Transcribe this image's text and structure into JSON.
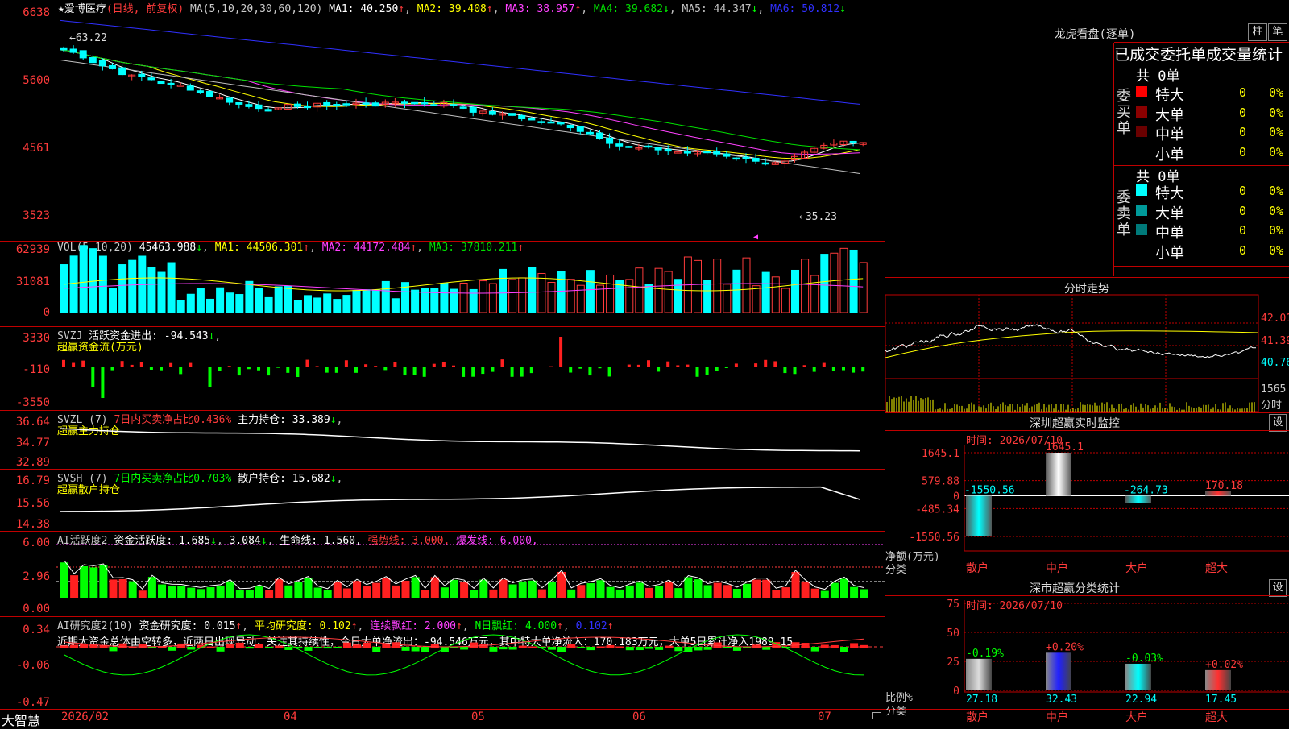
{
  "main": {
    "header": {
      "star": "★",
      "name": "爱博医疗",
      "mode": "(日线, 前复权)",
      "ma_label": "MA(5,10,20,30,60,120)",
      "ma": [
        {
          "text": "MA1: 40.250",
          "arrow": "↑",
          "color": "#ffffff"
        },
        {
          "text": "MA2: 39.408",
          "arrow": "↑",
          "color": "#ffff00"
        },
        {
          "text": "MA3: 38.957",
          "arrow": "↑",
          "color": "#ff40ff"
        },
        {
          "text": "MA4: 39.682",
          "arrow": "↓",
          "color": "#00e000"
        },
        {
          "text": "MA5: 44.347",
          "arrow": "↓",
          "color": "#c0c0c0"
        },
        {
          "text": "MA6: 50.812",
          "arrow": "↓",
          "color": "#3030ff"
        }
      ]
    },
    "yticks": [
      "6638",
      "5600",
      "4561",
      "3523"
    ],
    "high_label": "63.22",
    "low_label": "35.23"
  },
  "vol": {
    "header": "VOL(5,10,20)",
    "value": "45463.988",
    "ma1": "MA1: 44506.301",
    "ma2": "MA2: 44172.484",
    "ma3": "MA3: 37810.211",
    "yticks": [
      "62939",
      "31081",
      "0"
    ]
  },
  "svzj": {
    "header": "SVZJ",
    "label": "活跃资金进出: -94.543",
    "sub": "超赢资金流(万元)",
    "yticks": [
      "3330",
      "-110",
      "-3550"
    ]
  },
  "svzl": {
    "header": "SVZL (7)",
    "ratio": "7日内买卖净占比0.436%",
    "hold": "主力持仓: 33.389",
    "sub": "超赢主力持仓",
    "yticks": [
      "36.64",
      "34.77",
      "32.89"
    ]
  },
  "svsh": {
    "header": "SVSH (7)",
    "ratio": "7日内买卖净占比0.703%",
    "hold": "散户持仓: 15.682",
    "sub": "超赢散户持仓",
    "yticks": [
      "16.79",
      "15.56",
      "14.38"
    ]
  },
  "ai1": {
    "header": "AI活跃度2",
    "a": "资金活跃度: 1.685",
    "b": "3.084",
    "c": "生命线: 1.560,",
    "d": "强势线: 3.000,",
    "e": "爆发线: 6.000,",
    "yticks": [
      "6.00",
      "2.96",
      "0.00"
    ]
  },
  "ai2": {
    "header": "AI研究度2(10)",
    "a": "资金研究度: 0.015",
    "b": "平均研究度: 0.102",
    "c": "连续飘红: 2.000",
    "d": "N日飘红: 4.000",
    "e": "0.102",
    "comment": "近期大资金总体由空转多，近两日出现异动，关注其持续性，今日大单净流出：-94.546万元，其中特大单净流入：170.183万元，大单5日累计净入1989.15",
    "yticks": [
      "0.34",
      "-0.06",
      "-0.47"
    ]
  },
  "xaxis": {
    "corner": "大智慧",
    "labels": [
      "2026/02",
      "04",
      "05",
      "06",
      "07"
    ]
  },
  "lhb": {
    "title": "龙虎看盘(逐单)",
    "btn1": "柱",
    "btn2": "笔",
    "subtitle": "已成交委托单成交量统计",
    "buy": {
      "side": "委买单",
      "total": "共 0单",
      "rows": [
        {
          "label": "特大",
          "val": "0",
          "pct": "0%",
          "color": "#ff0000"
        },
        {
          "label": "大单",
          "val": "0",
          "pct": "0%",
          "color": "#8b0000"
        },
        {
          "label": "中单",
          "val": "0",
          "pct": "0%",
          "color": "#6a0000"
        },
        {
          "label": "小单",
          "val": "0",
          "pct": "0%",
          "color": "#000000"
        }
      ]
    },
    "sell": {
      "side": "委卖单",
      "total": "共 0单",
      "rows": [
        {
          "label": "特大",
          "val": "0",
          "pct": "0%",
          "color": "#00ffff"
        },
        {
          "label": "大单",
          "val": "0",
          "pct": "0%",
          "color": "#009a9a"
        },
        {
          "label": "中单",
          "val": "0",
          "pct": "0%",
          "color": "#007a7a"
        },
        {
          "label": "小单",
          "val": "0",
          "pct": "0%",
          "color": "#000000"
        }
      ]
    }
  },
  "intraday": {
    "title": "分时走势",
    "yticks": [
      "42.01",
      "41.39",
      "40.76"
    ],
    "vol_label": "1565",
    "vol_unit": "分时"
  },
  "sz_monitor": {
    "title": "深圳超赢实时监控",
    "btn": "设",
    "time": "时间: 2026/07/10",
    "yticks": [
      "1645.1",
      "579.88",
      "0",
      "-485.34",
      "-1550.56"
    ],
    "ylabel1": "净额(万元)",
    "ylabel2": "分类",
    "bars": [
      {
        "cat": "散户",
        "value": -1550.56,
        "label": "-1550.56"
      },
      {
        "cat": "中户",
        "value": 1645.1,
        "label": "1645.1"
      },
      {
        "cat": "大户",
        "value": -264.73,
        "label": "-264.73"
      },
      {
        "cat": "超大",
        "value": 170.18,
        "label": "170.18"
      }
    ]
  },
  "sz_stats": {
    "title": "深市超赢分类统计",
    "btn": "设",
    "time": "时间: 2026/07/10",
    "yticks": [
      "75",
      "50",
      "25",
      "0"
    ],
    "ylabel1": "比例%",
    "ylabel2": "分类",
    "bars": [
      {
        "cat": "散户",
        "value": 27.18,
        "label": "27.18",
        "chg": "-0.19%",
        "chg_color": "#00ff00"
      },
      {
        "cat": "中户",
        "value": 32.43,
        "label": "32.43",
        "chg": "+0.20%",
        "chg_color": "#ff3b3b"
      },
      {
        "cat": "大户",
        "value": 22.94,
        "label": "22.94",
        "chg": "-0.03%",
        "chg_color": "#00ff00"
      },
      {
        "cat": "超大",
        "value": 17.45,
        "label": "17.45",
        "chg": "+0.02%",
        "chg_color": "#ff3b3b"
      }
    ]
  }
}
